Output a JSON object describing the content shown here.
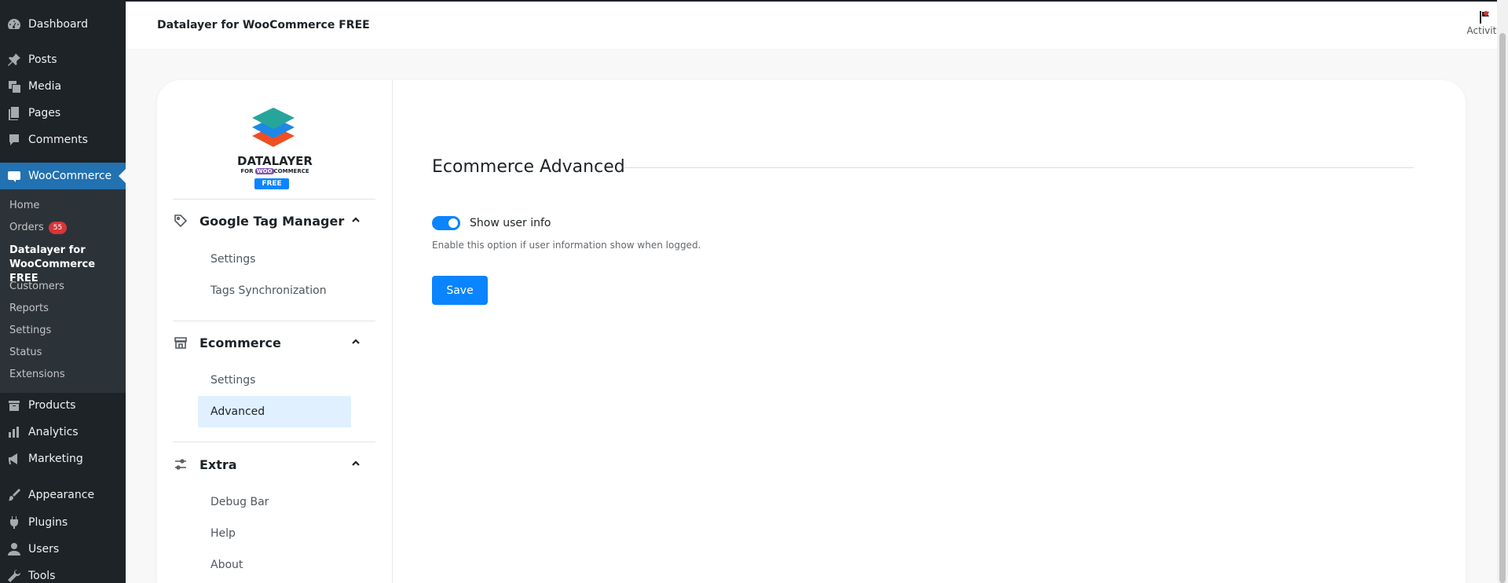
{
  "wp_menu": {
    "items": [
      {
        "label": "Dashboard",
        "icon": "dashboard-icon"
      },
      {
        "label": "Posts",
        "icon": "pin-icon"
      },
      {
        "label": "Media",
        "icon": "media-icon"
      },
      {
        "label": "Pages",
        "icon": "pages-icon"
      },
      {
        "label": "Comments",
        "icon": "comment-icon"
      },
      {
        "label": "WooCommerce",
        "icon": "woo-icon"
      },
      {
        "label": "Products",
        "icon": "archive-icon"
      },
      {
        "label": "Analytics",
        "icon": "bar-chart-icon"
      },
      {
        "label": "Marketing",
        "icon": "megaphone-icon"
      },
      {
        "label": "Appearance",
        "icon": "brush-icon"
      },
      {
        "label": "Plugins",
        "icon": "plug-icon"
      },
      {
        "label": "Users",
        "icon": "user-icon"
      },
      {
        "label": "Tools",
        "icon": "wrench-icon"
      }
    ],
    "woo_sub": [
      {
        "label": "Home"
      },
      {
        "label": "Orders",
        "badge": "55"
      },
      {
        "label": "Datalayer for",
        "label2": "WooCommerce FREE"
      },
      {
        "label": "Customers"
      },
      {
        "label": "Reports"
      },
      {
        "label": "Settings"
      },
      {
        "label": "Status"
      },
      {
        "label": "Extensions"
      }
    ]
  },
  "header": {
    "title": "Datalayer for WooCommerce FREE",
    "activity_label": "Activity"
  },
  "logo": {
    "name": "DATALAYER",
    "for": "FOR",
    "woo": "WOO",
    "commerce": "COMMERCE",
    "free": "FREE"
  },
  "plugin_nav": {
    "groups": [
      {
        "label": "Google Tag Manager",
        "icon": "tag-icon",
        "links": [
          "Settings",
          "Tags Synchronization"
        ]
      },
      {
        "label": "Ecommerce",
        "icon": "store-icon",
        "links": [
          "Settings",
          "Advanced"
        ]
      },
      {
        "label": "Extra",
        "icon": "sliders-icon",
        "links": [
          "Debug Bar",
          "Help",
          "About"
        ]
      }
    ]
  },
  "content": {
    "section_title": "Ecommerce Advanced",
    "toggle_label": "Show user info",
    "toggle_on": true,
    "toggle_help": "Enable this option if user information show when logged.",
    "save_label": "Save"
  },
  "colors": {
    "wp_sidebar": "#1d2327",
    "wp_active": "#2271b1",
    "accent": "#0a84ff",
    "active_link_bg": "#e0f0ff"
  }
}
